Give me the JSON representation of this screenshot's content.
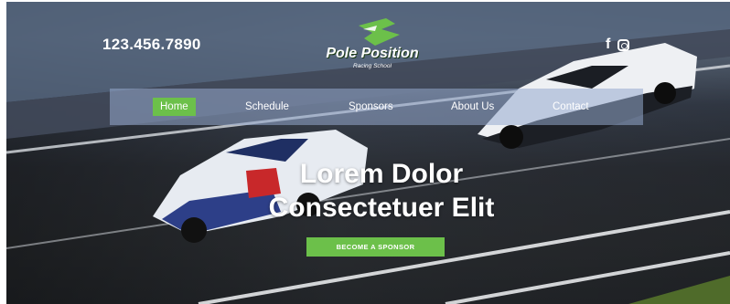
{
  "header": {
    "phone": "123.456.7890",
    "logo": {
      "title": "Pole Position",
      "subtitle": "Racing School"
    },
    "social": {
      "facebook": "f",
      "instagram_icon": "instagram-icon"
    }
  },
  "nav": {
    "items": [
      {
        "label": "Home",
        "active": true
      },
      {
        "label": "Schedule"
      },
      {
        "label": "Sponsors"
      },
      {
        "label": "About Us"
      },
      {
        "label": "Contact"
      }
    ]
  },
  "hero": {
    "headline_line1": "Lorem Dolor",
    "headline_line2": "Consectetuer Elit",
    "cta_label": "BECOME A SPONSOR"
  },
  "colors": {
    "accent_green": "#6cc04a",
    "nav_bar": "#96aacd",
    "track": "#2d3138"
  }
}
